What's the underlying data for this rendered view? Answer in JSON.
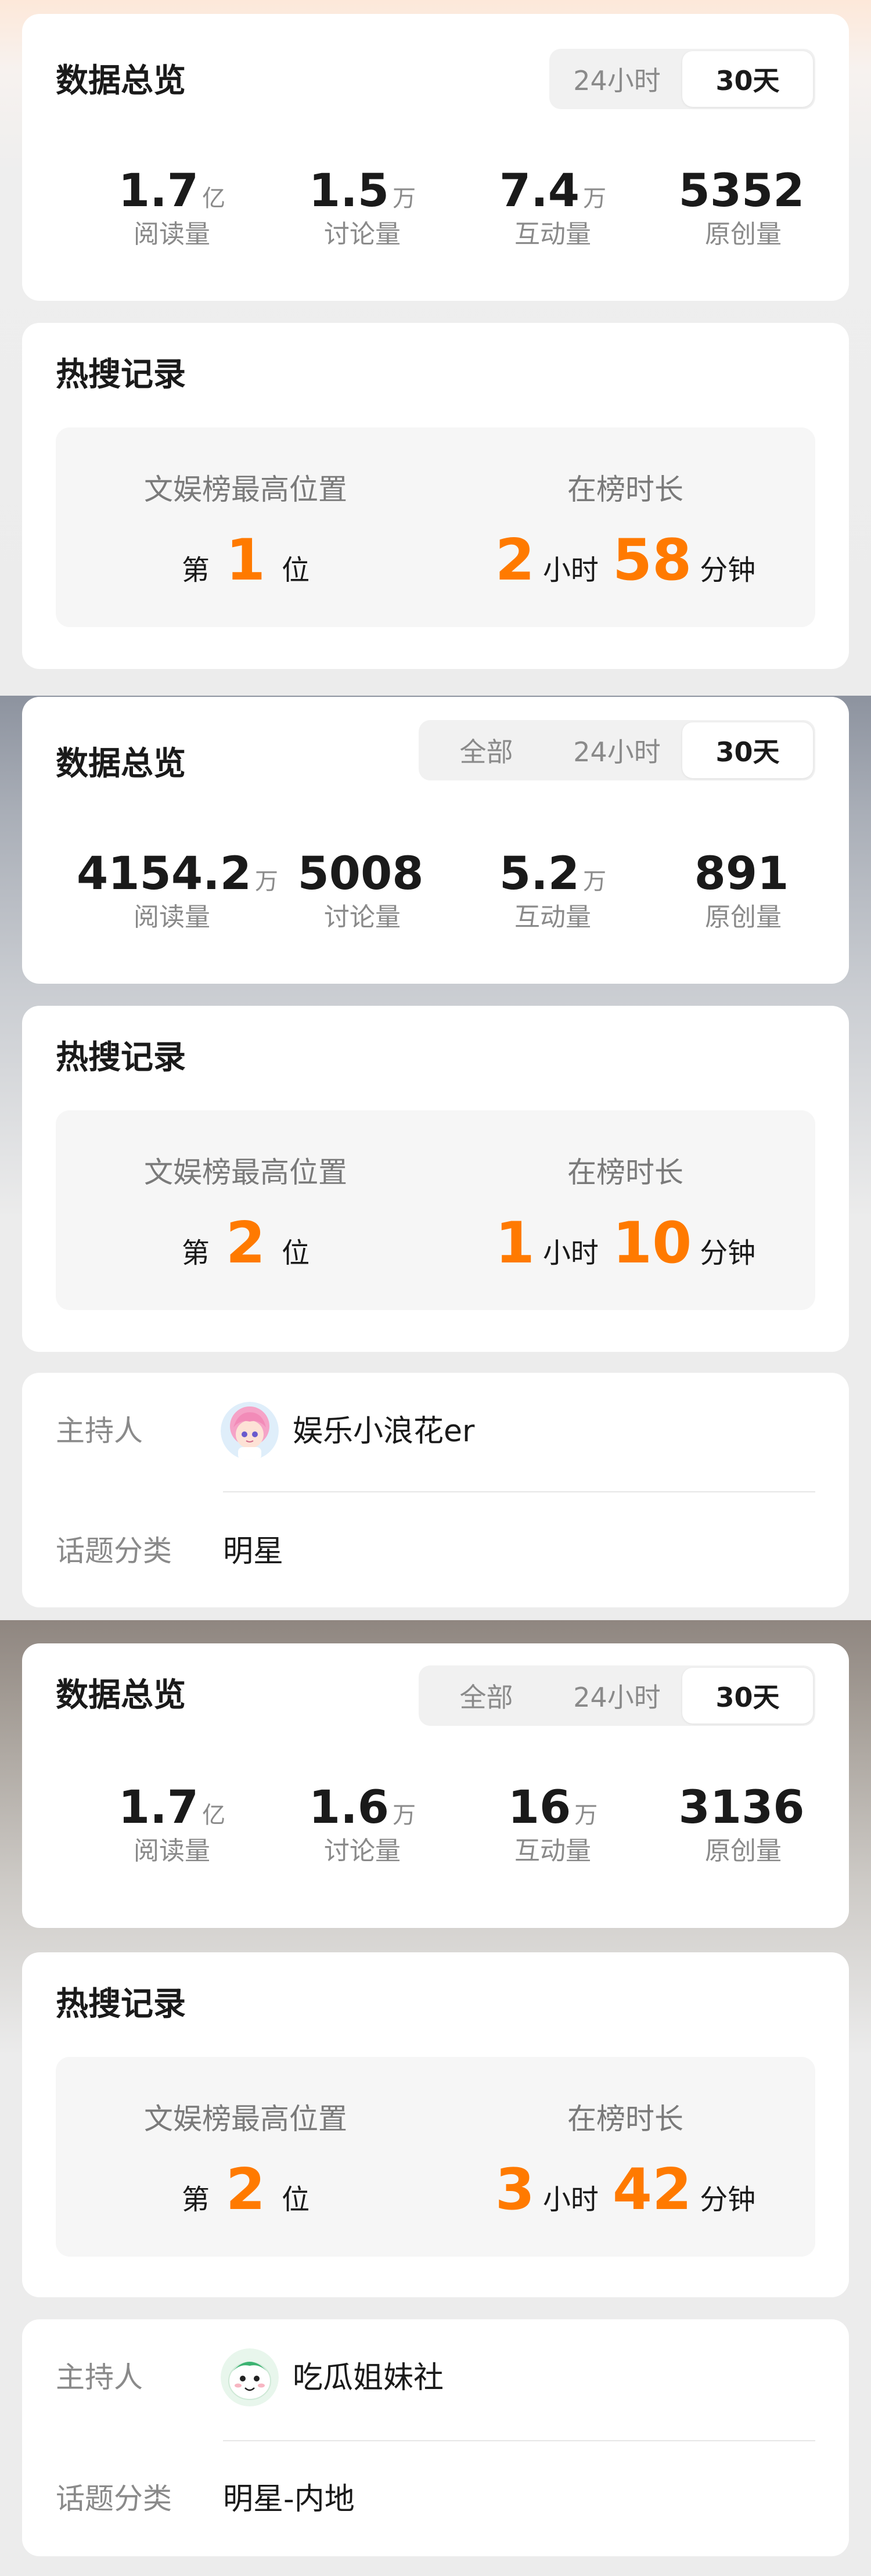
{
  "blocks": [
    {
      "overview": {
        "title": "数据总览",
        "tabs": [
          "24小时",
          "30天"
        ],
        "active_tab": "30天",
        "stats": [
          {
            "value": "1.7",
            "unit": "亿",
            "label": "阅读量"
          },
          {
            "value": "1.5",
            "unit": "万",
            "label": "讨论量"
          },
          {
            "value": "7.4",
            "unit": "万",
            "label": "互动量"
          },
          {
            "value": "5352",
            "unit": "",
            "label": "原创量"
          }
        ]
      },
      "hot": {
        "title": "热搜记录",
        "rank_label": "文娱榜最高位置",
        "rank_prefix": "第",
        "rank_value": "1",
        "rank_suffix": "位",
        "duration_label": "在榜时长",
        "hours": "2",
        "hours_unit": "小时",
        "minutes": "58",
        "minutes_unit": "分钟"
      }
    },
    {
      "overview": {
        "title": "数据总览",
        "tabs": [
          "全部",
          "24小时",
          "30天"
        ],
        "active_tab": "30天",
        "stats": [
          {
            "value": "4154.2",
            "unit": "万",
            "label": "阅读量"
          },
          {
            "value": "5008",
            "unit": "",
            "label": "讨论量"
          },
          {
            "value": "5.2",
            "unit": "万",
            "label": "互动量"
          },
          {
            "value": "891",
            "unit": "",
            "label": "原创量"
          }
        ]
      },
      "hot": {
        "title": "热搜记录",
        "rank_label": "文娱榜最高位置",
        "rank_prefix": "第",
        "rank_value": "2",
        "rank_suffix": "位",
        "duration_label": "在榜时长",
        "hours": "1",
        "hours_unit": "小时",
        "minutes": "10",
        "minutes_unit": "分钟"
      },
      "info": {
        "host_label": "主持人",
        "host_name": "娱乐小浪花er",
        "host_avatar": "pink-hair-cartoon-avatar",
        "category_label": "话题分类",
        "category_value": "明星"
      }
    },
    {
      "overview": {
        "title": "数据总览",
        "tabs": [
          "全部",
          "24小时",
          "30天"
        ],
        "active_tab": "30天",
        "stats": [
          {
            "value": "1.7",
            "unit": "亿",
            "label": "阅读量"
          },
          {
            "value": "1.6",
            "unit": "万",
            "label": "讨论量"
          },
          {
            "value": "16",
            "unit": "万",
            "label": "互动量"
          },
          {
            "value": "3136",
            "unit": "",
            "label": "原创量"
          }
        ]
      },
      "hot": {
        "title": "热搜记录",
        "rank_label": "文娱榜最高位置",
        "rank_prefix": "第",
        "rank_value": "2",
        "rank_suffix": "位",
        "duration_label": "在榜时长",
        "hours": "3",
        "hours_unit": "小时",
        "minutes": "42",
        "minutes_unit": "分钟"
      },
      "info": {
        "host_label": "主持人",
        "host_name": "吃瓜姐妹社",
        "host_avatar": "melon-cartoon-avatar",
        "category_label": "话题分类",
        "category_value": "明星-内地"
      }
    }
  ],
  "colors": {
    "accent_orange": "#ff7a00",
    "card_bg": "#ffffff",
    "muted_text": "#8a8a8a"
  }
}
